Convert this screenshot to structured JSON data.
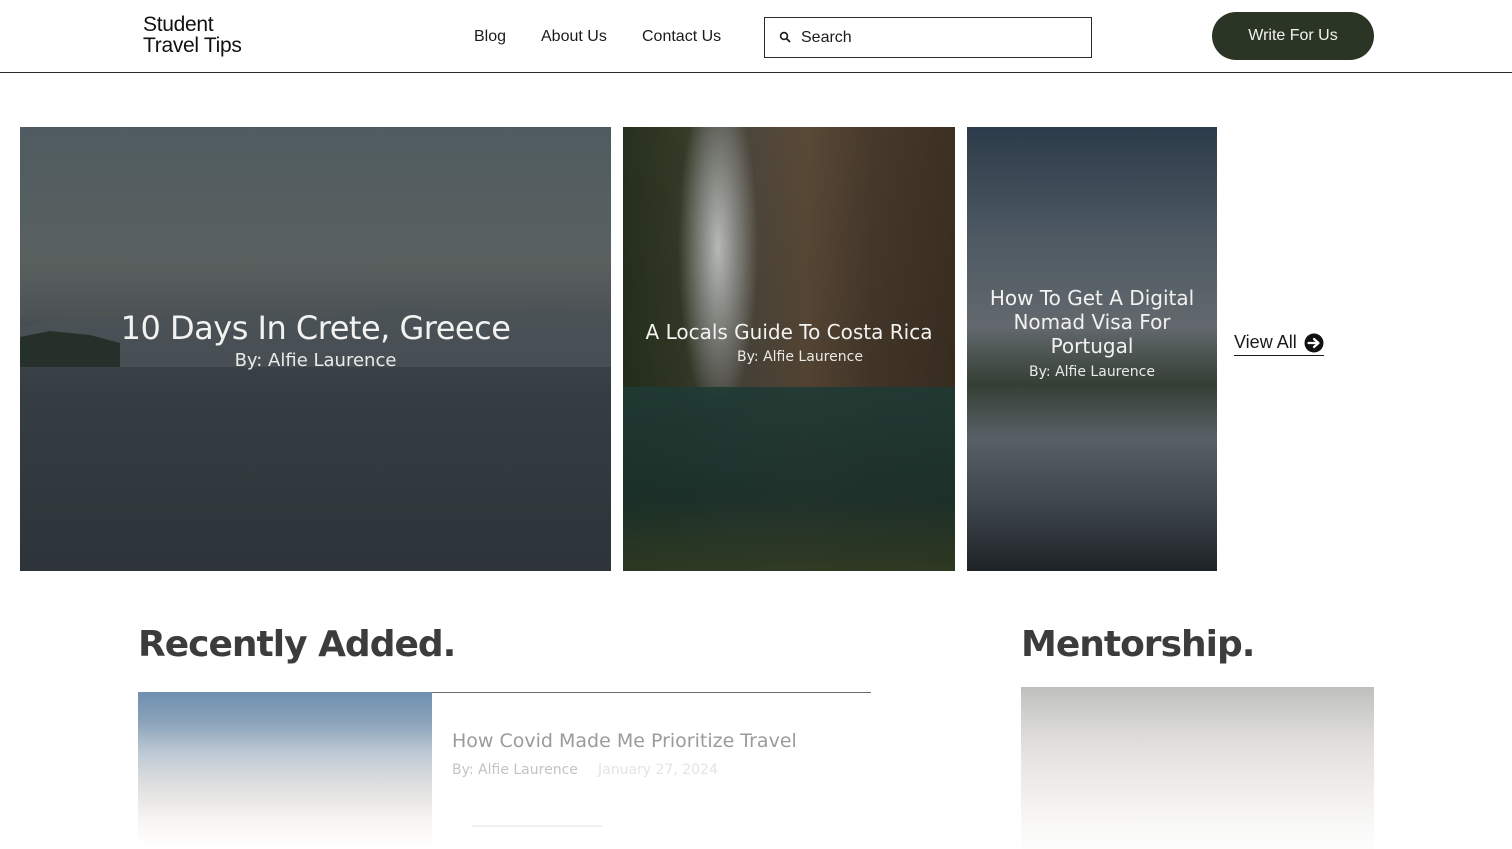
{
  "header": {
    "logo_line1": "Student",
    "logo_line2": "Travel Tips",
    "nav": [
      "Blog",
      "About Us",
      "Contact Us"
    ],
    "search_placeholder": "Search",
    "cta_label": "Write For Us"
  },
  "featured": [
    {
      "title": "10 Days In Crete, Greece",
      "author": "By: Alfie Laurence"
    },
    {
      "title": "A Locals Guide To Costa Rica",
      "author": "By: Alfie Laurence"
    },
    {
      "title": "How To Get A Digital Nomad Visa For Portugal",
      "author": "By: Alfie Laurence"
    }
  ],
  "view_all_label": "View All",
  "recent": {
    "heading": "Recently Added.",
    "items": [
      {
        "title": "How Covid Made Me Prioritize Travel",
        "author": "By: Alfie Laurence",
        "date": "January 27, 2024"
      }
    ]
  },
  "mentorship": {
    "heading": "Mentorship."
  },
  "colors": {
    "cta_bg": "#2b3525",
    "text": "#1b1b1b"
  }
}
